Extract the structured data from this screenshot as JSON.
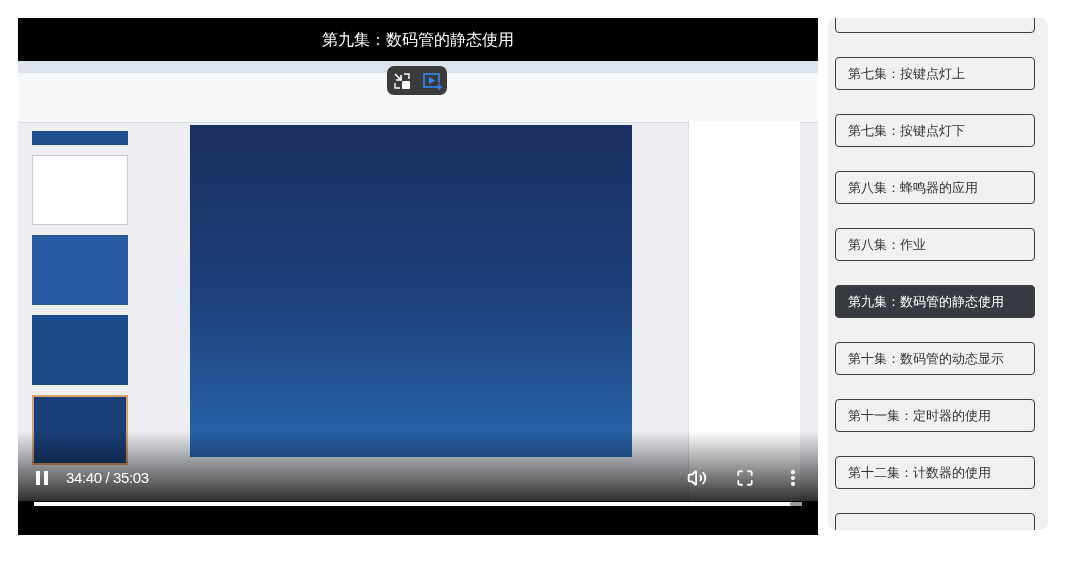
{
  "player": {
    "title": "第九集：数码管的静态使用",
    "playing": true,
    "time": "34:40 / 35:03",
    "progress": {
      "level": 0.985
    }
  },
  "playlist": {
    "items": [
      {
        "label": "第七集：按键点灯上",
        "selected": false
      },
      {
        "label": "第七集：按键点灯下",
        "selected": false
      },
      {
        "label": "第八集：蜂鸣器的应用",
        "selected": false
      },
      {
        "label": "第八集：作业",
        "selected": false
      },
      {
        "label": "第九集：数码管的静态使用",
        "selected": true
      },
      {
        "label": "第十集：数码管的动态显示",
        "selected": false
      },
      {
        "label": "第十一集：定时器的使用",
        "selected": false
      },
      {
        "label": "第十二集：计数器的使用",
        "selected": false
      }
    ]
  }
}
